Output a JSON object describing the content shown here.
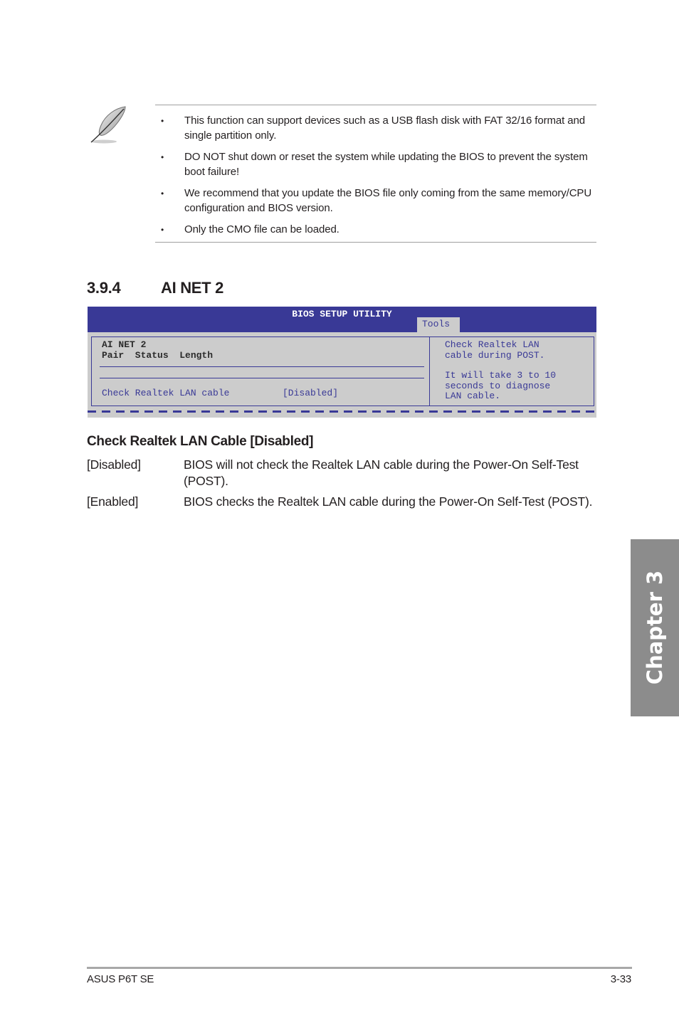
{
  "note": {
    "icon": "feather-pen-icon",
    "items": [
      "This function can support devices such as a USB flash disk with FAT 32/16 format and single partition only.",
      "DO NOT shut down or reset the system while updating the BIOS to prevent the system boot failure!",
      "We recommend that you update the BIOS file only coming from the same memory/CPU configuration and BIOS version.",
      "Only the CMO file can be loaded."
    ]
  },
  "section": {
    "number": "3.9.4",
    "title": "AI NET 2"
  },
  "bios": {
    "title": "BIOS SETUP UTILITY",
    "active_tab": "Tools",
    "left": {
      "heading": "AI NET 2",
      "columns": "Pair  Status  Length",
      "item_label": "Check Realtek LAN cable",
      "item_value": "[Disabled]"
    },
    "help": {
      "line1": "Check Realtek LAN",
      "line2": "cable during POST.",
      "line3": "It will take 3 to 10",
      "line4": "seconds to diagnose",
      "line5": "LAN cable."
    },
    "colors": {
      "header": "#393996",
      "panel": "#cccccc"
    }
  },
  "option": {
    "heading": "Check Realtek LAN Cable [Disabled]",
    "values": [
      {
        "key": "[Disabled]",
        "desc": "BIOS will not check the Realtek LAN cable during the Power-On Self-Test (POST)."
      },
      {
        "key": "[Enabled]",
        "desc": "BIOS checks the Realtek LAN cable during the Power-On Self-Test (POST)."
      }
    ]
  },
  "chapter_tab": "Chapter 3",
  "footer": {
    "product": "ASUS P6T SE",
    "page": "3-33"
  }
}
